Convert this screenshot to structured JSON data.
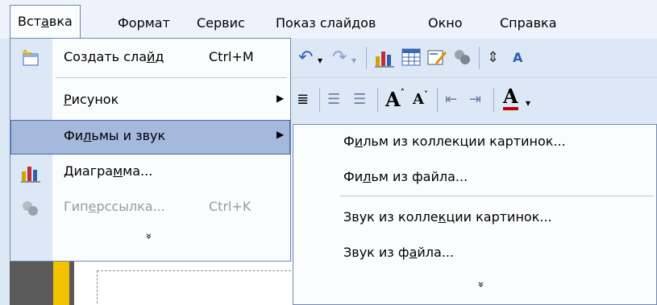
{
  "menubar": {
    "items": [
      {
        "label": "Вставка",
        "active": true
      },
      {
        "label": "Формат"
      },
      {
        "label": "Сервис"
      },
      {
        "label": "Показ слайдов"
      },
      {
        "label": "Окно"
      },
      {
        "label": "Справка"
      }
    ]
  },
  "insert_menu": {
    "items": [
      {
        "label": "Создать слайд",
        "shortcut": "Ctrl+M",
        "icon": "new-slide-icon"
      },
      {
        "label": "Рисунок",
        "submenu": true
      },
      {
        "label": "Фильмы и звук",
        "submenu": true,
        "highlighted": true
      },
      {
        "label": "Диаграмма...",
        "icon": "chart-icon"
      },
      {
        "label": "Гиперссылка...",
        "shortcut": "Ctrl+K",
        "icon": "hyperlink-icon",
        "disabled": true
      }
    ],
    "expand_glyph": "»"
  },
  "movies_submenu": {
    "items": [
      {
        "label": "Фильм из коллекции картинок..."
      },
      {
        "label": "Фильм из файла..."
      },
      {
        "label": "Звук из коллекции картинок..."
      },
      {
        "label": "Звук из файла..."
      }
    ],
    "expand_glyph": "»"
  },
  "toolbar": {
    "font_size_up": "A",
    "font_size_down": "A",
    "font_color": "A"
  },
  "colors": {
    "menu_highlight": "#a5b9dd",
    "menu_border": "#6f87b3",
    "gutter": "#dde8f7"
  }
}
